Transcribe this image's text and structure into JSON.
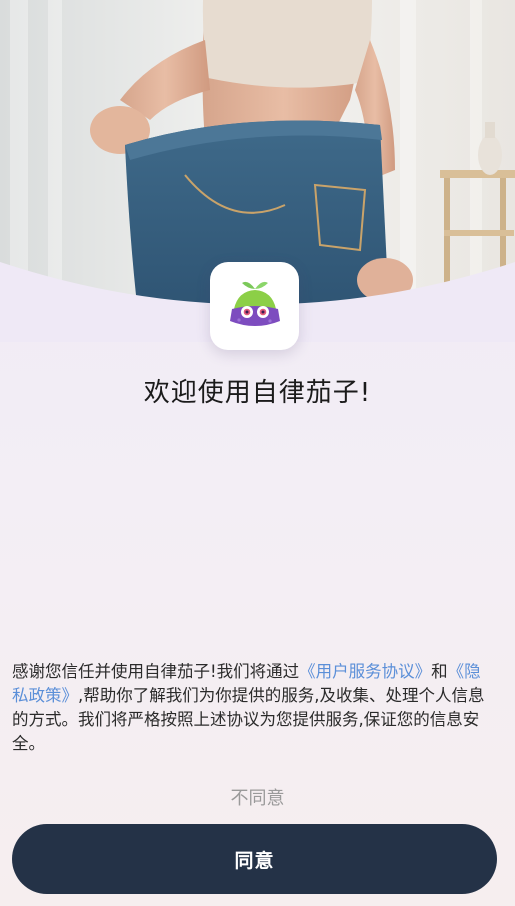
{
  "hero": {
    "image_desc_icon": "weight-loss-photo"
  },
  "app": {
    "logo_icon": "eggplant-mascot-icon"
  },
  "welcome": {
    "title": "欢迎使用自律茄子!"
  },
  "notice": {
    "part1": "感谢您信任并使用自律茄子!我们将通过",
    "user_agreement": "《用户服务协议》",
    "part2": "和",
    "privacy_policy": "《隐私政策》",
    "part3": ",帮助你了解我们为你提供的服务,及收集、处理个人信息的方式。我们将严格按照上述协议为您提供服务,保证您的信息安全。"
  },
  "actions": {
    "disagree_label": "不同意",
    "agree_label": "同意"
  },
  "colors": {
    "link": "#5b8fd8",
    "primary_button": "#243247",
    "secondary_text": "#9a9a9a"
  }
}
